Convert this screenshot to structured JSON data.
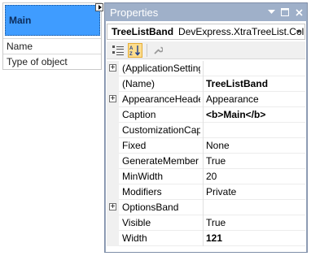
{
  "treelist": {
    "band_caption": "Main",
    "rows": [
      "Name",
      "Type of object"
    ]
  },
  "properties": {
    "title": "Properties",
    "object_name": "TreeListBand",
    "object_type": "DevExpress.XtraTreeList.Col",
    "items": [
      {
        "name": "(ApplicationSettings)",
        "value": "",
        "expandable": true,
        "bold": false
      },
      {
        "name": "(Name)",
        "value": "TreeListBand",
        "expandable": false,
        "bold": true
      },
      {
        "name": "AppearanceHeader",
        "value": "Appearance",
        "expandable": true,
        "bold": false
      },
      {
        "name": "Caption",
        "value": "<b>Main</b>",
        "expandable": false,
        "bold": true
      },
      {
        "name": "CustomizationCaption",
        "value": "",
        "expandable": false,
        "bold": false
      },
      {
        "name": "Fixed",
        "value": "None",
        "expandable": false,
        "bold": false
      },
      {
        "name": "GenerateMember",
        "value": "True",
        "expandable": false,
        "bold": false
      },
      {
        "name": "MinWidth",
        "value": "20",
        "expandable": false,
        "bold": false
      },
      {
        "name": "Modifiers",
        "value": "Private",
        "expandable": false,
        "bold": false
      },
      {
        "name": "OptionsBand",
        "value": "",
        "expandable": true,
        "bold": false
      },
      {
        "name": "Visible",
        "value": "True",
        "expandable": false,
        "bold": false
      },
      {
        "name": "Width",
        "value": "121",
        "expandable": false,
        "bold": true
      }
    ]
  },
  "colors": {
    "band_fill": "#3f9cff",
    "title_bar": "#9fb0c9",
    "selected_tool": "#fcdd8e"
  },
  "icons": [
    "smart-tag-icon",
    "dropdown-arrow-icon",
    "pin-icon",
    "maximize-icon",
    "close-icon",
    "categorized-icon",
    "alphabetical-icon",
    "wrench-icon",
    "expand-icon"
  ]
}
